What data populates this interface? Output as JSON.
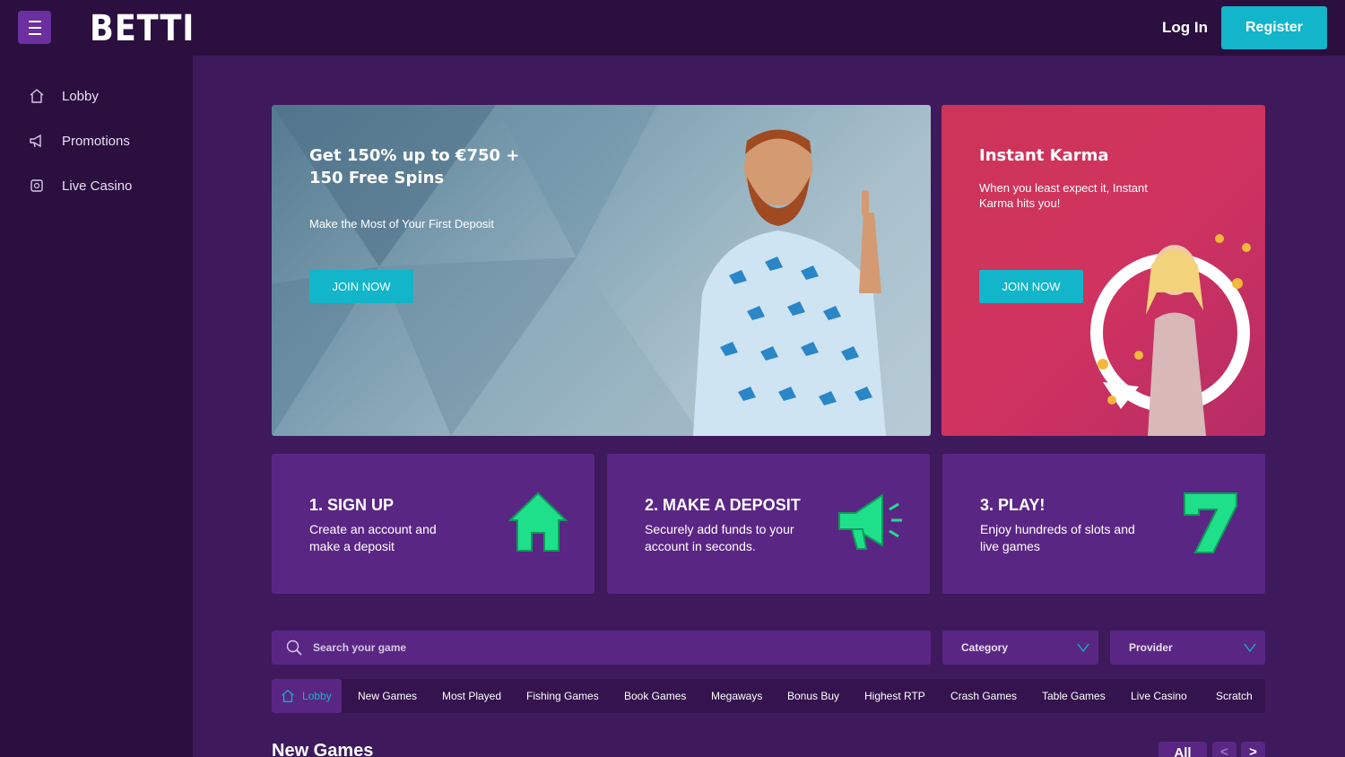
{
  "header": {
    "logo": "BETTI",
    "login_label": "Log In",
    "register_label": "Register"
  },
  "sidebar": {
    "items": [
      {
        "label": "Lobby",
        "icon": "home-icon"
      },
      {
        "label": "Promotions",
        "icon": "megaphone-icon"
      },
      {
        "label": "Live Casino",
        "icon": "live-casino-icon"
      }
    ]
  },
  "banners": [
    {
      "title_line1": "Get 150% up to €750 +",
      "title_line2": "150 Free Spins",
      "subtitle": "Make the Most of Your First Deposit",
      "button": "JOIN NOW"
    },
    {
      "title_line1": "Instant Karma",
      "subtitle_line1": "When you least expect it, Instant",
      "subtitle_line2": "Karma hits you!",
      "button": "JOIN NOW"
    }
  ],
  "steps": [
    {
      "title": "1. SIGN UP",
      "desc": "Create an account and make a deposit",
      "icon": "house-icon"
    },
    {
      "title": "2. MAKE A DEPOSIT",
      "desc": "Securely add funds to your account in seconds.",
      "icon": "megaphone-icon"
    },
    {
      "title": "3. PLAY!",
      "desc": "Enjoy hundreds of slots and live games",
      "icon": "seven-icon"
    }
  ],
  "search": {
    "placeholder": "Search your game",
    "category_label": "Category",
    "provider_label": "Provider"
  },
  "tabs": [
    "Lobby",
    "New Games",
    "Most Played",
    "Fishing Games",
    "Book Games",
    "Megaways",
    "Bonus Buy",
    "Highest RTP",
    "Crash Games",
    "Table Games",
    "Live Casino",
    "Scratch"
  ],
  "new_games": {
    "title": "New Games",
    "all_label": "All",
    "prev_label": "<",
    "next_label": ">"
  },
  "colors": {
    "accent": "#12b5c9",
    "background": "#3e1a5c",
    "panel": "#5a2684",
    "header": "#2a0f3f",
    "icon_green": "#1fe08a"
  }
}
